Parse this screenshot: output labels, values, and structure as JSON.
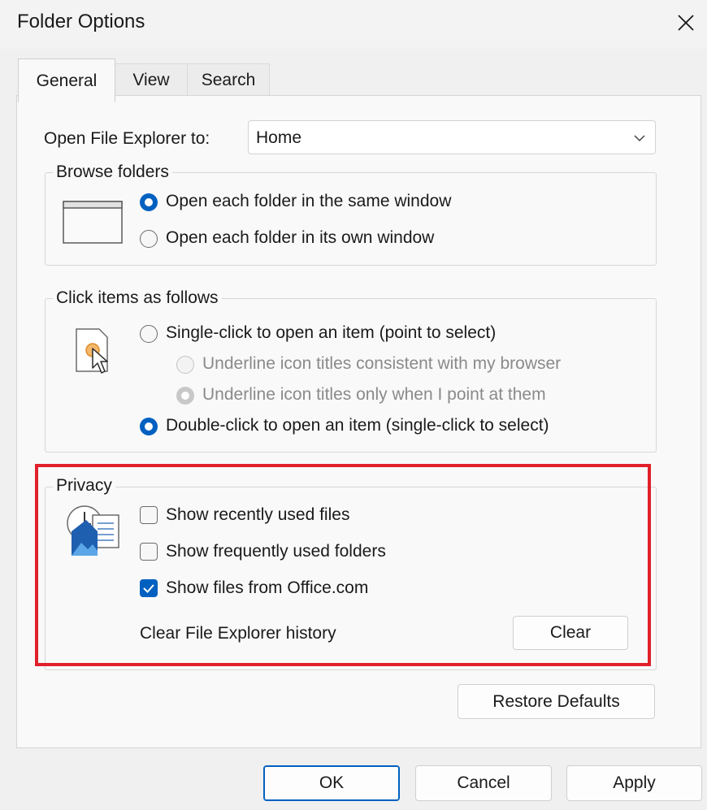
{
  "window": {
    "title": "Folder Options"
  },
  "tabs": [
    {
      "label": "General"
    },
    {
      "label": "View"
    },
    {
      "label": "Search"
    }
  ],
  "general": {
    "open_to": {
      "label": "Open File Explorer to:",
      "value": "Home"
    },
    "browse_folders": {
      "title": "Browse folders",
      "options": [
        {
          "label": "Open each folder in the same window",
          "checked": true
        },
        {
          "label": "Open each folder in its own window",
          "checked": false
        }
      ]
    },
    "click_items": {
      "title": "Click items as follows",
      "single_click": "Single-click to open an item (point to select)",
      "underline_browser": "Underline icon titles consistent with my browser",
      "underline_point": "Underline icon titles only when I point at them",
      "double_click": "Double-click to open an item (single-click to select)"
    },
    "privacy": {
      "title": "Privacy",
      "show_recent": {
        "label": "Show recently used files",
        "checked": false
      },
      "show_frequent": {
        "label": "Show frequently used folders",
        "checked": false
      },
      "show_office": {
        "label": "Show files from Office.com",
        "checked": true
      },
      "clear_label": "Clear File Explorer history",
      "clear_button": "Clear"
    },
    "restore_defaults": "Restore Defaults"
  },
  "footer": {
    "ok": "OK",
    "cancel": "Cancel",
    "apply": "Apply"
  },
  "colors": {
    "accent": "#0060c0",
    "highlight": "#e0202a"
  }
}
